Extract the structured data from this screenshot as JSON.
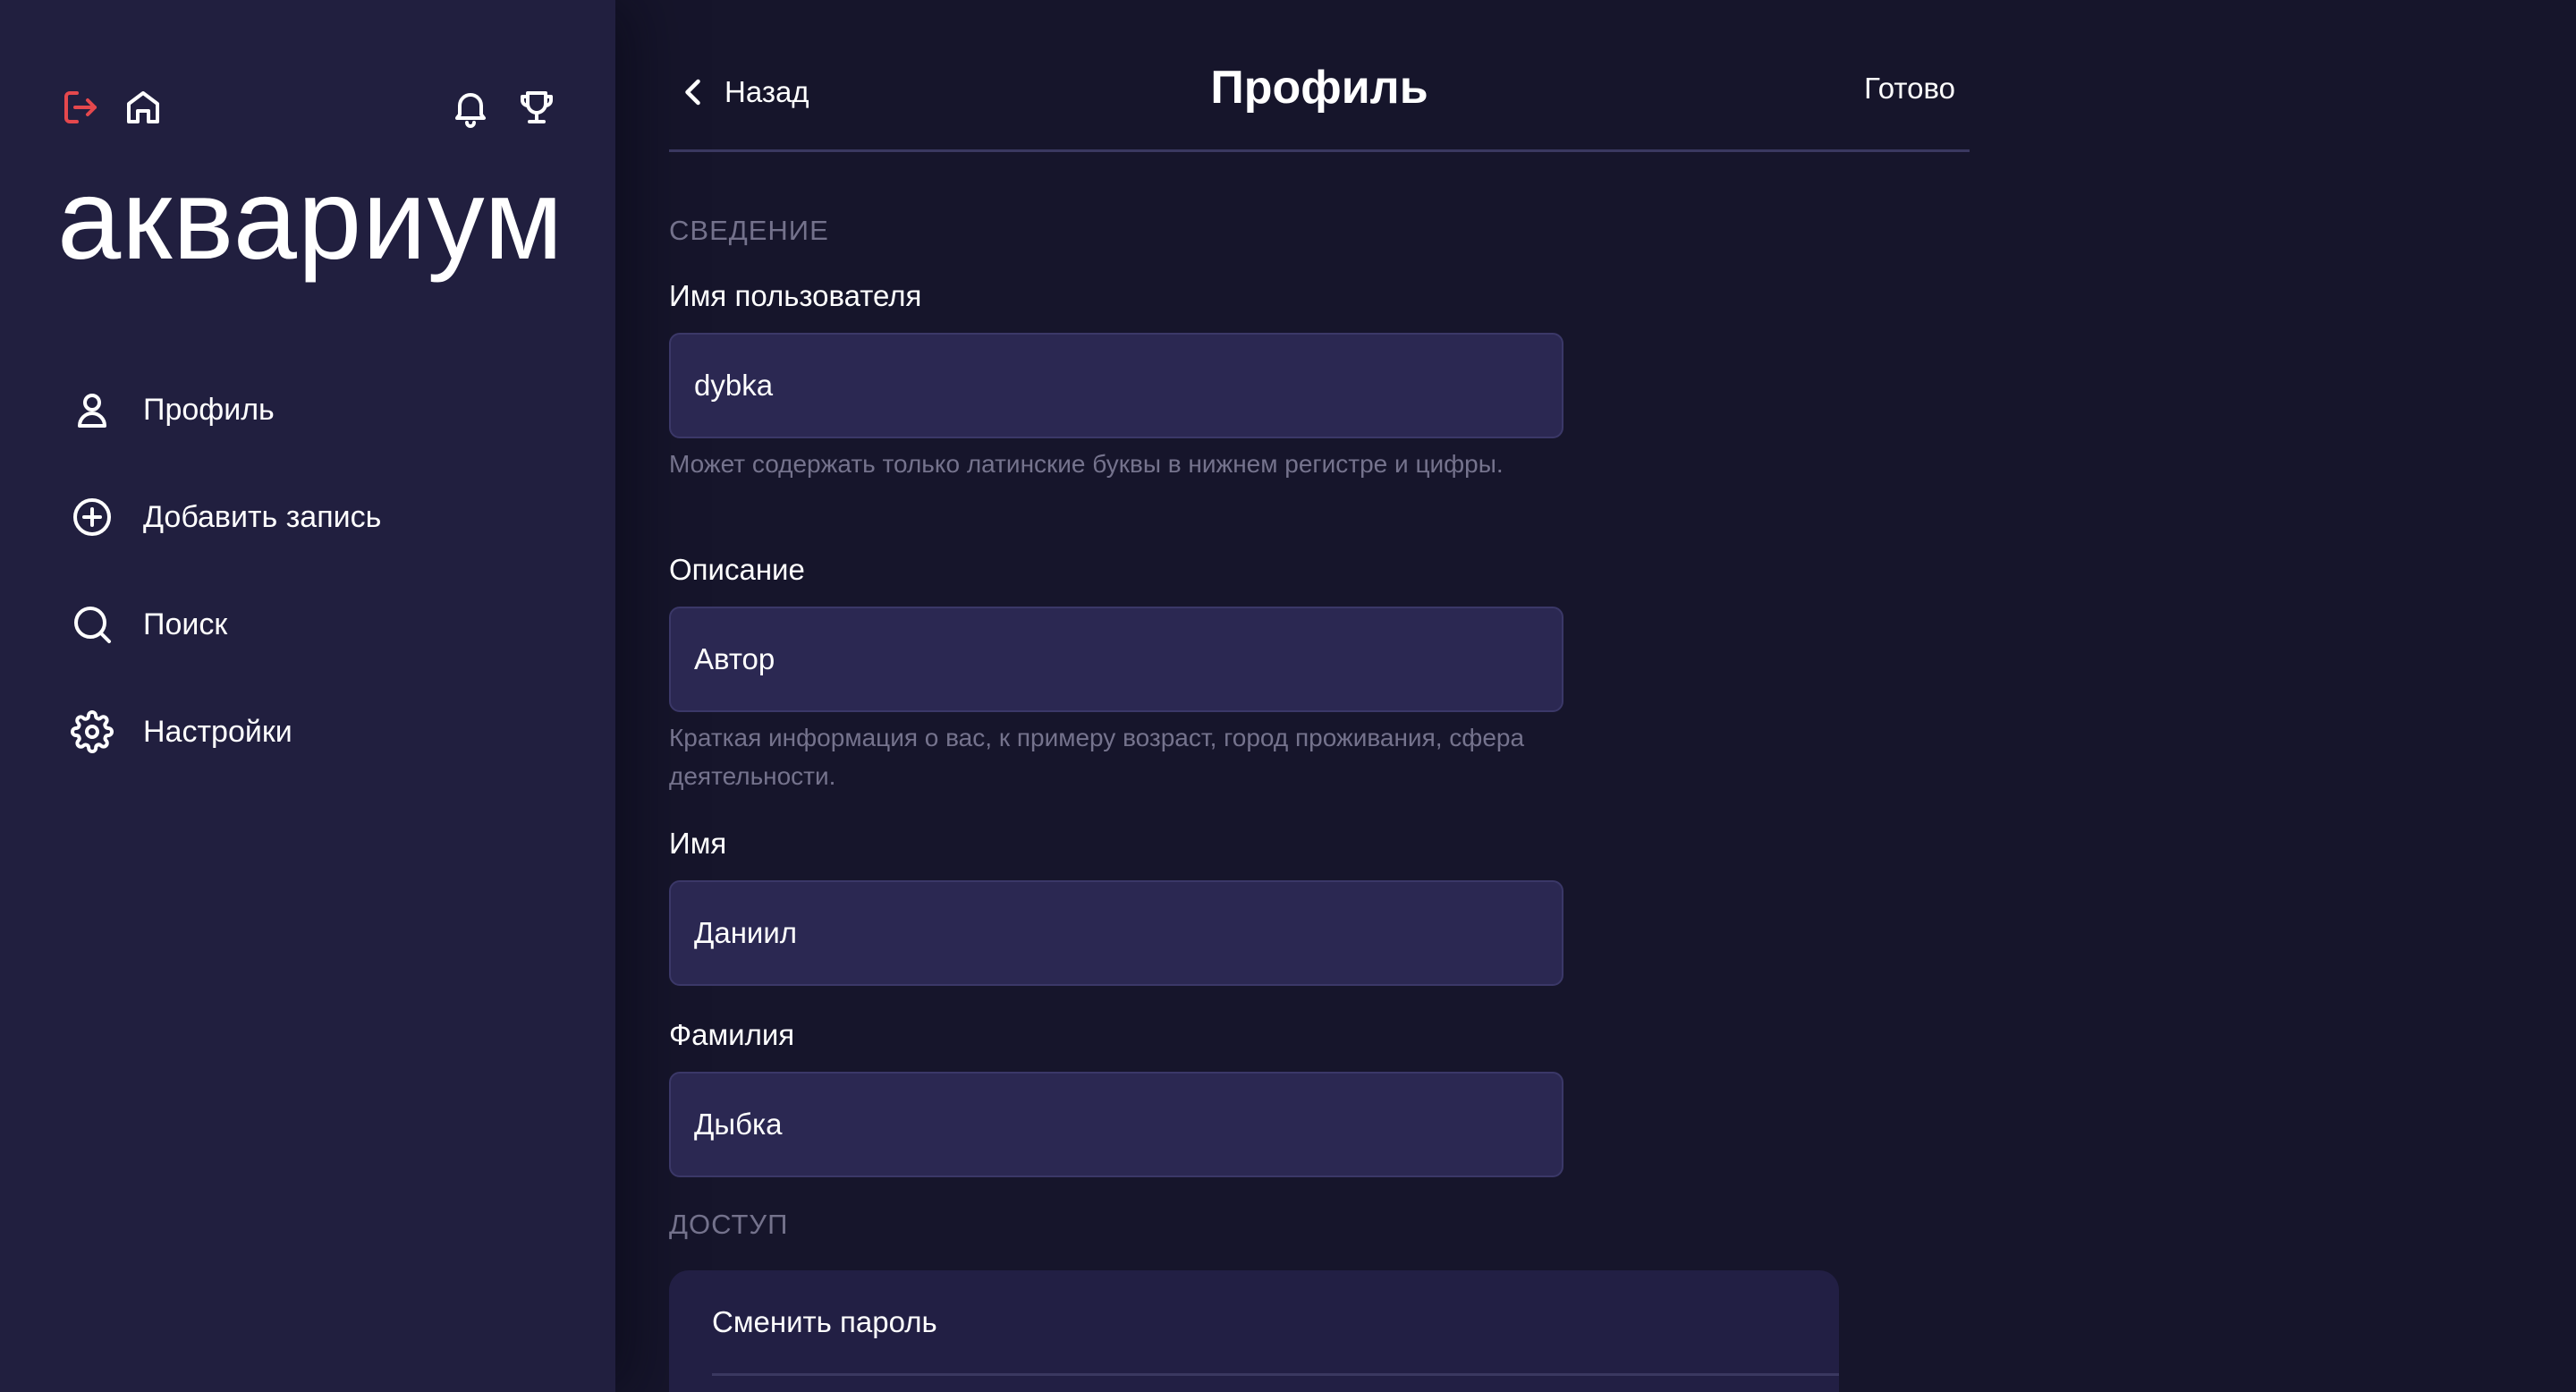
{
  "sidebar": {
    "logo": "аквариум",
    "icons": {
      "logout": "logout-icon",
      "home": "home-icon",
      "notifications": "bell-icon",
      "achievements": "trophy-icon"
    },
    "nav": [
      {
        "label": "Профиль",
        "icon": "user-icon"
      },
      {
        "label": "Добавить запись",
        "icon": "plus-circle-icon"
      },
      {
        "label": "Поиск",
        "icon": "search-icon"
      },
      {
        "label": "Настройки",
        "icon": "gear-icon"
      }
    ]
  },
  "header": {
    "back_label": "Назад",
    "title": "Профиль",
    "done_label": "Готово"
  },
  "form": {
    "section_info": "СВЕДЕНИЕ",
    "username": {
      "label": "Имя пользователя",
      "value": "dybka",
      "hint": "Может содержать только латинские буквы в нижнем регистре и цифры."
    },
    "description": {
      "label": "Описание",
      "value": "Автор",
      "hint": "Краткая информация о вас, к примеру возраст, город проживания, сфера деятельности."
    },
    "first_name": {
      "label": "Имя",
      "value": "Даниил"
    },
    "last_name": {
      "label": "Фамилия",
      "value": "Дыбка"
    },
    "section_access": "ДОСТУП",
    "change_password_label": "Сменить пароль"
  },
  "colors": {
    "background": "#16152b",
    "sidebar": "#211f3f",
    "field": "#2b2852",
    "accent_logout": "#e5484d",
    "muted_text": "#75738d"
  }
}
